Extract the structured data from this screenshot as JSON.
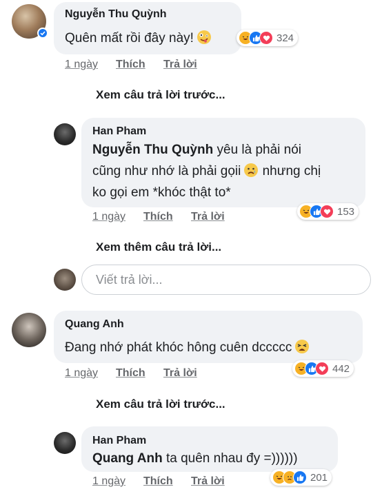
{
  "comments": [
    {
      "author": "Nguyễn Thu Quỳnh",
      "text": "Quên mất rồi đây này!",
      "time": "1 ngày",
      "like": "Thích",
      "reply": "Trả lời",
      "reaction_count": "324",
      "reactions": [
        "haha-icon",
        "like-icon",
        "love-icon"
      ]
    },
    {
      "author": "Han Pham",
      "mention": "Nguyễn Thu Quỳnh",
      "text_lines": [
        " yêu là phải nói",
        "cũng như nhớ là phải gọii",
        "ko gọi em *khóc thật to*"
      ],
      "text_suffix_line2": " nhưng chị",
      "time": "1 ngày",
      "like": "Thích",
      "reply": "Trả lời",
      "reaction_count": "153",
      "reactions": [
        "haha-icon",
        "like-icon",
        "love-icon"
      ]
    },
    {
      "author": "Quang Anh",
      "text": "Đang nhớ phát khóc hông cuên dccccc",
      "time": "1 ngày",
      "like": "Thích",
      "reply": "Trả lời",
      "reaction_count": "442",
      "reactions": [
        "haha-icon",
        "like-icon",
        "love-icon"
      ]
    },
    {
      "author": "Han Pham",
      "mention": "Quang Anh",
      "text": " ta quên nhau đy =))))))",
      "time": "1 ngày",
      "like": "Thích",
      "reply": "Trả lời",
      "reaction_count": "201",
      "reactions": [
        "haha-icon",
        "sad-icon",
        "like-icon"
      ]
    }
  ],
  "links": {
    "previous_replies_1": "Xem câu trả lời trước...",
    "more_replies": "Xem thêm câu trả lời...",
    "previous_replies_2": "Xem câu trả lời trước..."
  },
  "reply_box": {
    "placeholder": "Viết trả lời..."
  },
  "colors": {
    "bubble": "#f0f2f5",
    "meta": "#65676b",
    "like": "#1877f2",
    "love": "#f33e58",
    "haha": "#f7b125"
  }
}
